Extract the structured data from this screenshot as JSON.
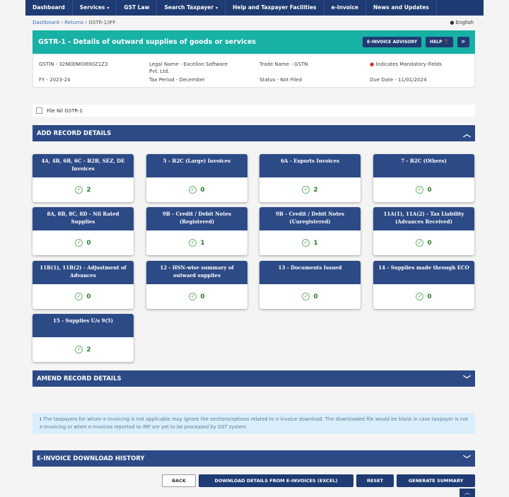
{
  "nav": {
    "items": [
      {
        "label": "Dashboard",
        "caret": ""
      },
      {
        "label": "Services",
        "caret": "▾"
      },
      {
        "label": "GST Law",
        "caret": ""
      },
      {
        "label": "Search Taxpayer",
        "caret": "▾"
      },
      {
        "label": "Help and Taxpayer Facilities",
        "caret": ""
      },
      {
        "label": "e-Invoice",
        "caret": ""
      },
      {
        "label": "News and Updates",
        "caret": ""
      }
    ]
  },
  "breadcrumb": {
    "dashboard": "Dashboard",
    "sep": " › ",
    "returns": "Returns",
    "current": "GSTR-1/IFF"
  },
  "language": "English",
  "header": {
    "title": "GSTR-1 - Details of outward supplies of goods or services",
    "einvoice_advisory": "E-INVOICE ADVISORY",
    "help": "HELP"
  },
  "info": {
    "gstin": "GSTIN - 32NEENK0690Z1Z3",
    "legal_name_1": "Legal Name - Excellon Software",
    "legal_name_2": "Pvt. Ltd.",
    "trade_name": "Trade Name - GSTN",
    "mandatory": "Indicates Mandatory Fields",
    "fy": "FY - 2023-24",
    "tax_period": "Tax Period - December",
    "status": "Status - Not Filed",
    "due_date": "Due Date - 11/01/2024"
  },
  "file_nil": "File Nil GSTR-1",
  "sections": {
    "add": "ADD RECORD DETAILS",
    "amend": "AMEND RECORD DETAILS",
    "einvoice_history": "E-INVOICE DOWNLOAD HISTORY"
  },
  "tiles": [
    {
      "title": "4A, 4B, 6B, 6C - B2B, SEZ, DE Invoices",
      "count": "2"
    },
    {
      "title": "5 - B2C (Large) Invoices",
      "count": "0"
    },
    {
      "title": "6A - Exports Invoices",
      "count": "2"
    },
    {
      "title": "7 - B2C (Others)",
      "count": "0"
    },
    {
      "title": "8A, 8B, 8C, 8D - Nil Rated Supplies",
      "count": "0"
    },
    {
      "title": "9B - Credit / Debit Notes (Registered)",
      "count": "1"
    },
    {
      "title": "9B - Credit / Debit Notes (Unregistered)",
      "count": "1"
    },
    {
      "title": "11A(1), 11A(2) - Tax Liability (Advances Received)",
      "count": "0"
    },
    {
      "title": "11B(1), 11B(2) - Adjustment of Advances",
      "count": "0"
    },
    {
      "title": "12 - HSN-wise summary of outward supplies",
      "count": "0"
    },
    {
      "title": "13 - Documents Issued",
      "count": "0"
    },
    {
      "title": "14 - Supplies made through ECO",
      "count": "0"
    },
    {
      "title": "15 - Supplies U/s 9(5)",
      "count": "2"
    }
  ],
  "notice": "The taxpayers for whom e-invoicing is not applicable may ignore the sections/options related to e-invoice download. The downloaded file would be blank in case taxpayer is not e-invoicing or when e-invoices reported to IRP are yet to be processed by GST system",
  "buttons": {
    "back": "BACK",
    "download": "DOWNLOAD DETAILS FROM E-INVOICES (EXCEL)",
    "reset": "RESET",
    "generate": "GENERATE SUMMARY"
  },
  "icons": {
    "check": "✓",
    "chevron_up": "︿",
    "chevron_down": "﹀",
    "info": "ℹ",
    "refresh": "⟳",
    "help": "❓"
  }
}
